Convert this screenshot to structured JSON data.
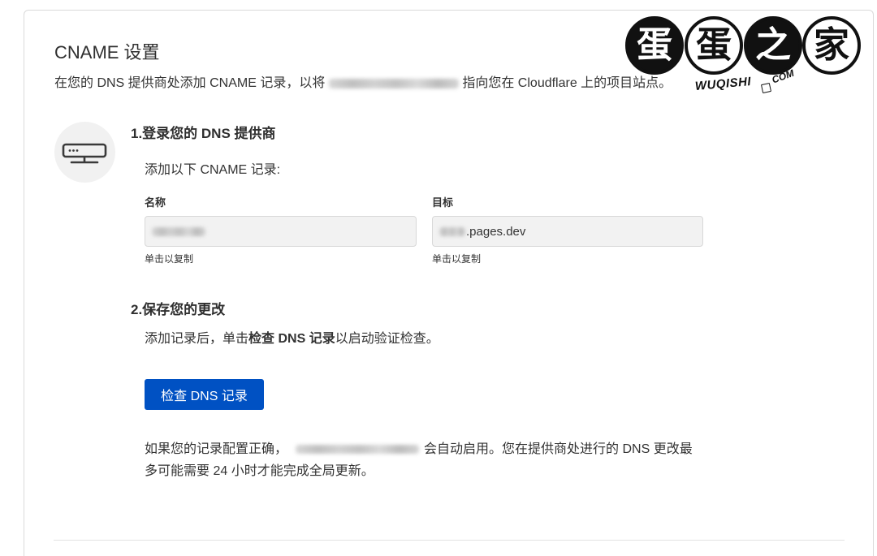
{
  "page": {
    "title": "CNAME 设置",
    "subtitle_before": "在您的 DNS 提供商处添加 CNAME 记录，以将",
    "subtitle_after": "指向您在 Cloudflare 上的项目站点。"
  },
  "watermark": {
    "chars": [
      "蛋",
      "蛋",
      "之",
      "家"
    ],
    "site": "WUQISHI",
    "domain": "COM"
  },
  "step1": {
    "icon": "server-icon",
    "heading": "1.登录您的 DNS 提供商",
    "instruction": "添加以下 CNAME 记录:",
    "name_label": "名称",
    "target_label": "目标",
    "target_value_suffix": ".pages.dev",
    "copy_hint": "单击以复制"
  },
  "step2": {
    "heading": "2.保存您的更改",
    "text_before": "添加记录后，单击",
    "text_bold": "检查 DNS 记录",
    "text_after": "以启动验证检查。",
    "button_label": "检查 DNS 记录",
    "note_before": "如果您的记录配置正确，",
    "note_line1_after": "会自动启用。您在提供商处进行的 DNS 更改最",
    "note_line2": "多可能需要 24 小时才能完成全局更新。"
  },
  "colors": {
    "accent": "#0051c3",
    "text": "#313131",
    "field_bg": "#f2f2f2",
    "border": "#dadada"
  }
}
